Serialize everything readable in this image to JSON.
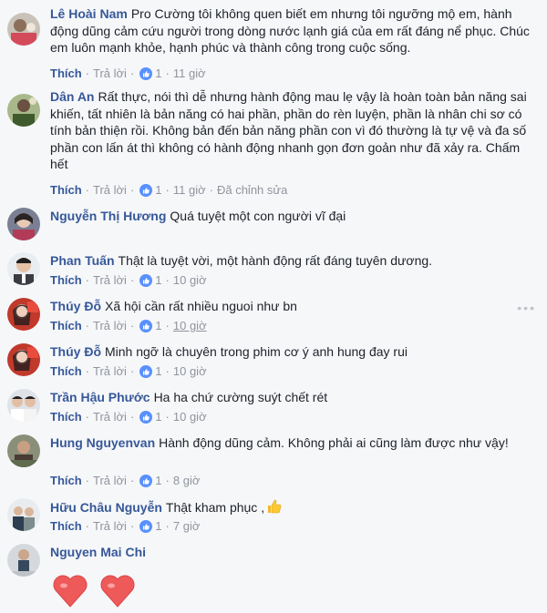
{
  "like_label": "Thích",
  "reply_label": "Trả lời",
  "comments": [
    {
      "author": "Lê Hoài Nam",
      "text": "Pro Cường tôi không quen biết em nhưng tôi ngưỡng mộ em, hành động dũng cảm cứu người trong dòng nước lạnh giá của em rất đáng nể phục. Chúc em luôn mạnh khỏe, hạnh phúc và thành công trong cuộc sống.",
      "likes": "1",
      "time": "11 giờ",
      "edited": ""
    },
    {
      "author": "Dân An",
      "text": "Rất thực, nói thì dễ nhưng hành động mau lẹ vậy là hoàn toàn bản năng sai khiến, tất nhiên là bản năng có hai phần, phần do rèn luyện, phần là nhân chi sơ có tính bản thiện rồi. Không bản đến bản năng phần con vì đó thường là tự vệ và đa số phần con lấn át thì không có hành động nhanh gọn đơn goản như đã xảy ra. Chấm hết",
      "likes": "1",
      "time": "11 giờ",
      "edited": "Đã chỉnh sửa"
    },
    {
      "author": "Nguyễn Thị Hương",
      "text": "Quá tuyệt một con người vĩ đại",
      "likes": "",
      "time": "",
      "edited": ""
    },
    {
      "author": "Phan Tuấn",
      "text": "Thật là tuyệt vời, một hành động rất đáng tuyên dương.",
      "likes": "1",
      "time": "10 giờ",
      "edited": ""
    },
    {
      "author": "Thúy Đỗ",
      "text": "Xã hội cần rất nhiều nguoi như bn",
      "likes": "1",
      "time": "10 giờ",
      "edited": ""
    },
    {
      "author": "Thúy Đỗ",
      "text": "Minh ngỡ là chuyên trong phim cơ ý anh hung đay rui",
      "likes": "1",
      "time": "10 giờ",
      "edited": ""
    },
    {
      "author": "Trần Hậu Phước",
      "text": "Ha ha chứ cường suýt chết rét",
      "likes": "1",
      "time": "10 giờ",
      "edited": ""
    },
    {
      "author": "Hung Nguyenvan",
      "text": "Hành động dũng cảm. Không phải ai cũng làm được như vậy!",
      "likes": "1",
      "time": "8 giờ",
      "edited": ""
    },
    {
      "author": "Hữu Châu Nguyễn",
      "text": "Thật kham phục ,",
      "likes": "1",
      "time": "7 giờ",
      "edited": ""
    },
    {
      "author": "Nguyen Mai Chi",
      "text": "",
      "likes": "",
      "time": "",
      "edited": ""
    }
  ],
  "colors": {
    "link": "#365899",
    "meta": "#90949c",
    "like_badge": "#5890ff",
    "background": "#f6f7f9"
  }
}
